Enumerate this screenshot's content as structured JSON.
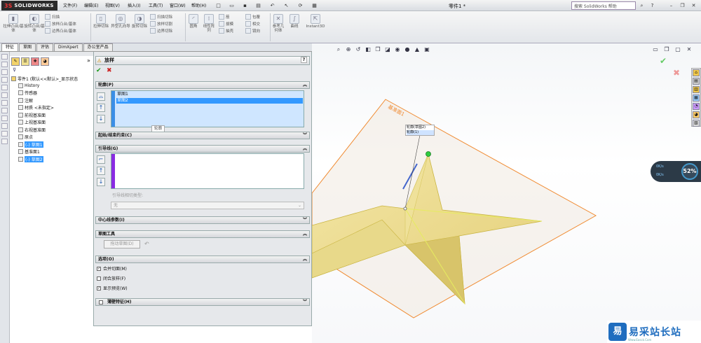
{
  "titlebar": {
    "brand": "SOLIDWORKS",
    "menus": [
      "文件(F)",
      "编辑(E)",
      "视图(V)",
      "插入(I)",
      "工具(T)",
      "窗口(W)",
      "帮助(H)"
    ],
    "doc_title": "零件1 *",
    "search_placeholder": "搜索 SolidWorks 帮助"
  },
  "command_manager": {
    "big_buttons": [
      "拉伸凸台/基体",
      "旋转凸台/基体",
      "拉伸切除",
      "异型孔向导",
      "旋转切除"
    ],
    "small_group1": [
      "扫描",
      "放样凸台/基体",
      "边界凸台/基体"
    ],
    "small_group2": [
      "扫描切除",
      "放样切割",
      "边界切除"
    ],
    "feature_buttons": [
      "圆角",
      "线性阵列"
    ],
    "small_group3": [
      "筋",
      "拔模",
      "抽壳"
    ],
    "small_group4": [
      "包覆",
      "相交",
      "镜向"
    ],
    "ref_buttons": [
      "参考几何体",
      "曲线"
    ],
    "instant3d": "Instant3D"
  },
  "tabs": [
    "特征",
    "草图",
    "评估",
    "DimXpert",
    "办公室产品"
  ],
  "tree": {
    "root": "零件1 (默认<<默认>_显示状态",
    "items": [
      {
        "label": "History",
        "indent": 1,
        "sel": false
      },
      {
        "label": "传感器",
        "indent": 1,
        "sel": false
      },
      {
        "label": "注解",
        "indent": 1,
        "sel": false
      },
      {
        "label": "材质 <未指定>",
        "indent": 1,
        "sel": false
      },
      {
        "label": "前视基准面",
        "indent": 1,
        "sel": false
      },
      {
        "label": "上视基准面",
        "indent": 1,
        "sel": false
      },
      {
        "label": "右视基准面",
        "indent": 1,
        "sel": false
      },
      {
        "label": "原点",
        "indent": 1,
        "sel": false
      },
      {
        "label": "(-) 草图1",
        "indent": 1,
        "sel": true
      },
      {
        "label": "基准面1",
        "indent": 1,
        "sel": false
      },
      {
        "label": "(-) 草图2",
        "indent": 1,
        "sel": true
      }
    ]
  },
  "pm": {
    "title": "放样",
    "profiles_header": "轮廓(P)",
    "profiles": [
      "草图1",
      "草图2"
    ],
    "tooltip": "轮廓",
    "start_end": "起始/结束约束(C)",
    "guides_header": "引导线(G)",
    "tangency_label": "引导线相切类型:",
    "tangency_value": "无",
    "centerline": "中心线参数(I)",
    "sketch_tools": "草图工具",
    "drag_sketch": "拖动草图(D)",
    "options_header": "选项(O)",
    "options": [
      {
        "label": "合并切面(M)",
        "checked": true
      },
      {
        "label": "闭合放样(F)",
        "checked": false
      },
      {
        "label": "显示预览(W)",
        "checked": true
      }
    ],
    "thin_feature": "薄壁特征(H)"
  },
  "graphics": {
    "plane_label": "基准面1",
    "callout_line1": "轮廓(草图2)",
    "callout_line2": "轮廓(1)",
    "perf_percent": "52%",
    "rate_up": "0K/s",
    "rate_down": "0K/s"
  },
  "watermark": {
    "logo_char": "易",
    "text": "易采站长站",
    "sub": "Www.Easck.Com"
  }
}
